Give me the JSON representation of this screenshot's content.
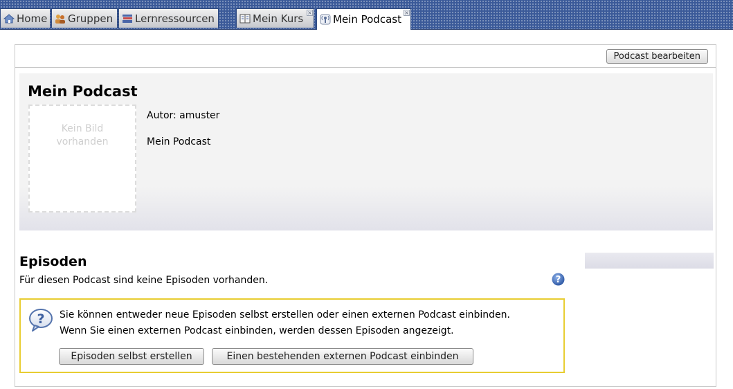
{
  "tabs": [
    {
      "label": "Home",
      "icon": "home-icon",
      "closable": false,
      "active": false
    },
    {
      "label": "Gruppen",
      "icon": "groups-icon",
      "closable": false,
      "active": false
    },
    {
      "label": "Lernressourcen",
      "icon": "learning-resources-icon",
      "closable": false,
      "active": false
    },
    {
      "label": "Mein Kurs",
      "icon": "course-icon",
      "closable": true,
      "active": false
    },
    {
      "label": "Mein Podcast",
      "icon": "podcast-icon",
      "closable": true,
      "active": true
    }
  ],
  "toolbar": {
    "edit_label": "Podcast bearbeiten"
  },
  "podcast": {
    "title": "Mein Podcast",
    "image_placeholder_line1": "Kein Bild",
    "image_placeholder_line2": "vorhanden",
    "author": "Autor: amuster",
    "description": "Mein Podcast"
  },
  "episodes": {
    "title": "Episoden",
    "empty_text": "Für diesen Podcast sind keine Episoden vorhanden.",
    "info_line1": "Sie können entweder neue Episoden selbst erstellen oder einen externen Podcast einbinden.",
    "info_line2": "Wenn Sie einen externen Podcast einbinden, werden dessen Episoden angezeigt.",
    "create_label": "Episoden selbst erstellen",
    "external_label": "Einen bestehenden externen Podcast einbinden"
  },
  "colors": {
    "topbar": "#3b5a99",
    "info_border": "#e8cd32",
    "help_icon": "#3e6bb5"
  }
}
